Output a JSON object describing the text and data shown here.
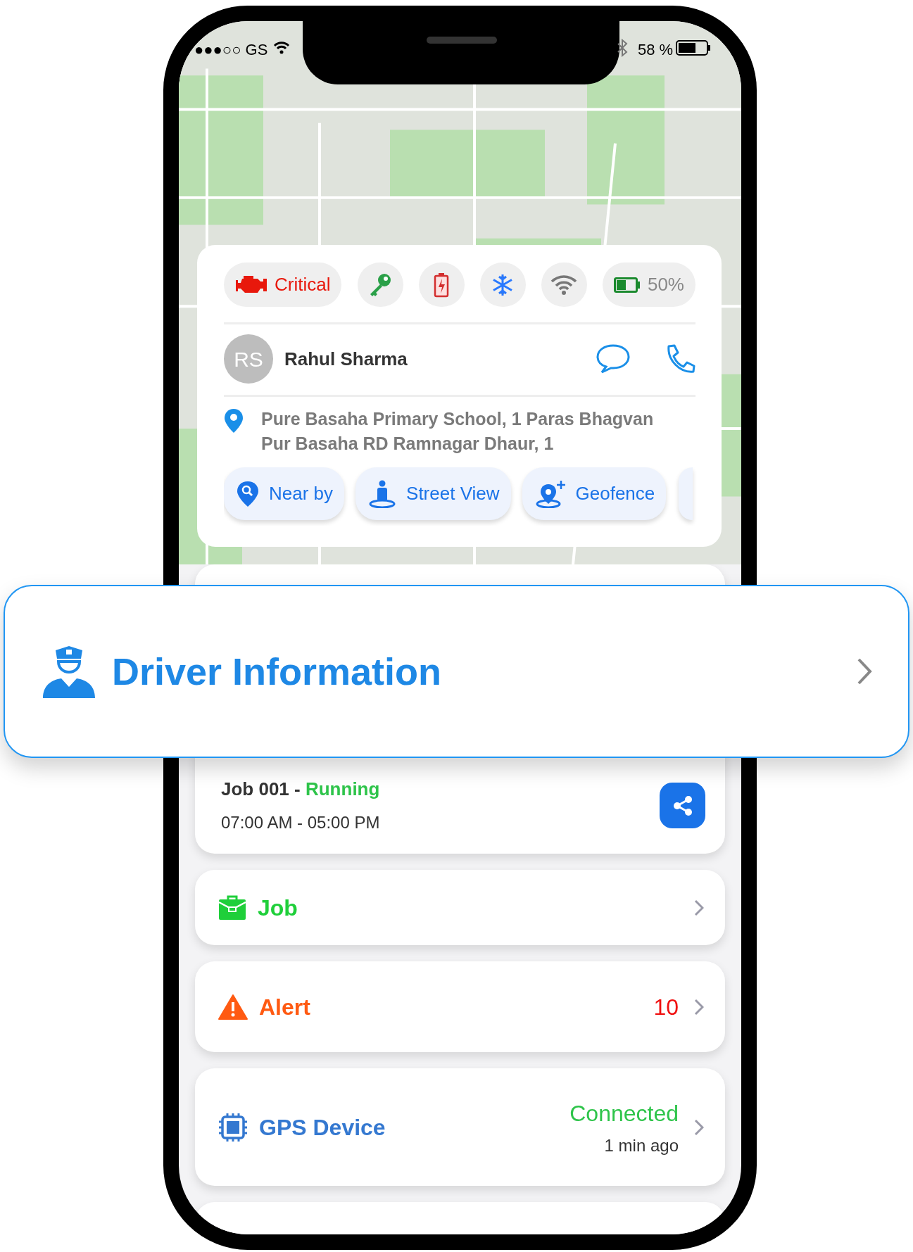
{
  "status_bar": {
    "carrier": "●●●○○ GS",
    "battery": "58 %"
  },
  "vehicle_status": [
    {
      "kind": "engine",
      "label": "Critical"
    },
    {
      "kind": "ignition"
    },
    {
      "kind": "power"
    },
    {
      "kind": "ac"
    },
    {
      "kind": "signal"
    },
    {
      "kind": "battery",
      "label": "50%"
    }
  ],
  "driver": {
    "initials": "RS",
    "name": "Rahul Sharma"
  },
  "address": "Pure Basaha Primary School, 1 Paras Bhagvan Pur Basaha RD Ramnagar Dhaur, 1",
  "actions": [
    {
      "kind": "nearby",
      "label": "Near by"
    },
    {
      "kind": "streetview",
      "label": "Street View"
    },
    {
      "kind": "geofence",
      "label": "Geofence"
    }
  ],
  "banner": {
    "title": "Driver Information"
  },
  "job_card": {
    "title": "Job 001 -",
    "status": "Running",
    "hours": "07:00 AM - 05:00 PM"
  },
  "menu": [
    {
      "kind": "job",
      "label": "Job"
    },
    {
      "kind": "alert",
      "label": "Alert",
      "count": "10"
    },
    {
      "kind": "gps",
      "label": "GPS Device",
      "status": "Connected",
      "time": "1 min ago"
    }
  ]
}
